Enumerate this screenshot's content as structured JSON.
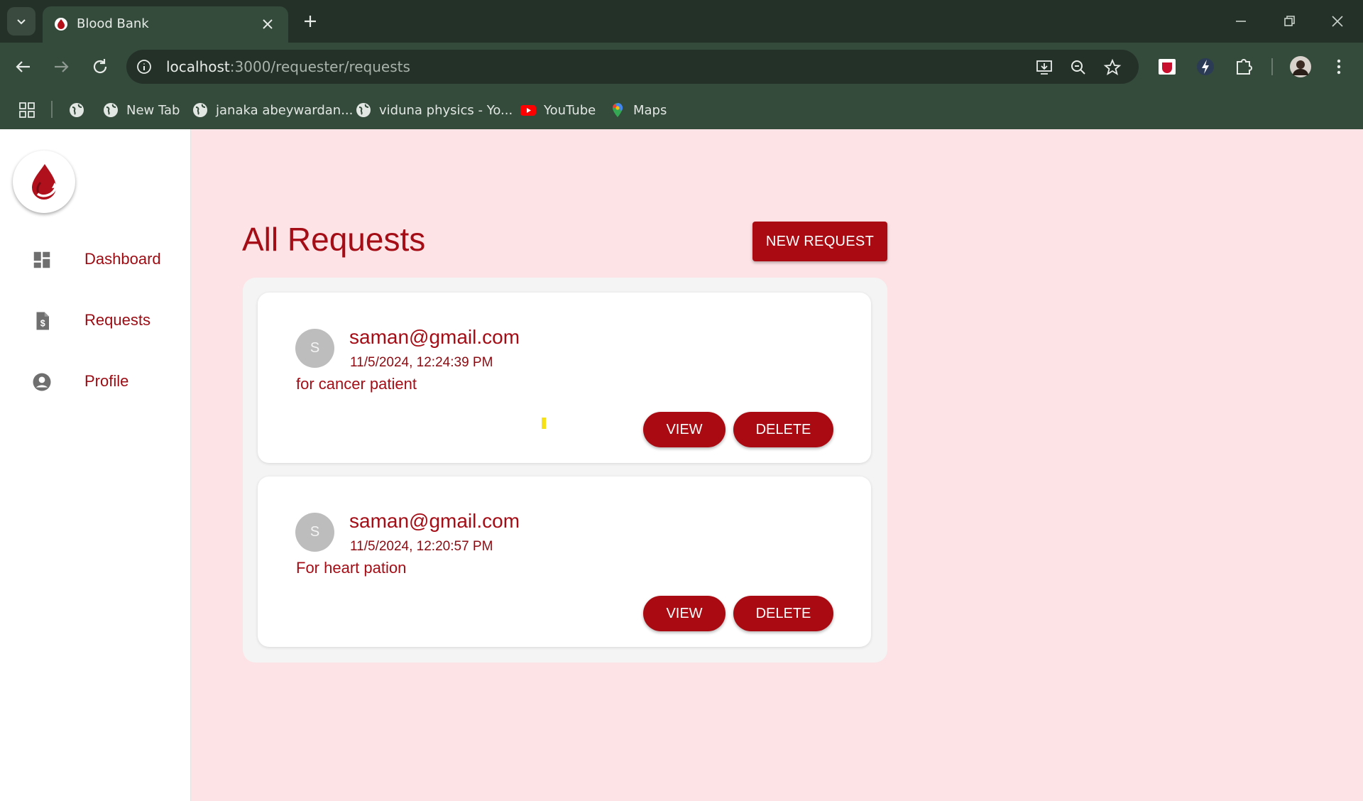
{
  "browser": {
    "tab_title": "Blood Bank",
    "url_host": "localhost",
    "url_path": ":3000/requester/requests",
    "bookmarks": [
      {
        "label": ""
      },
      {
        "label": "New Tab"
      },
      {
        "label": "janaka abeywardan..."
      },
      {
        "label": "viduna physics - Yo..."
      },
      {
        "label": "YouTube"
      },
      {
        "label": "Maps"
      }
    ]
  },
  "sidebar": {
    "items": [
      {
        "label": "Dashboard",
        "icon": "dashboard-icon"
      },
      {
        "label": "Requests",
        "icon": "document-dollar-icon"
      },
      {
        "label": "Profile",
        "icon": "account-circle-icon"
      }
    ]
  },
  "main": {
    "title": "All Requests",
    "new_request_label": "NEW REQUEST",
    "requests": [
      {
        "avatar": "S",
        "email": "saman@gmail.com",
        "date": "11/5/2024, 12:24:39 PM",
        "description": "for cancer patient",
        "view_label": "VIEW",
        "delete_label": "DELETE"
      },
      {
        "avatar": "S",
        "email": "saman@gmail.com",
        "date": "11/5/2024, 12:20:57 PM",
        "description": "For heart pation",
        "view_label": "VIEW",
        "delete_label": "DELETE"
      }
    ]
  },
  "colors": {
    "brand_red": "#aa0b12",
    "page_bg": "#fde3e5",
    "chrome_dark": "#243128"
  }
}
